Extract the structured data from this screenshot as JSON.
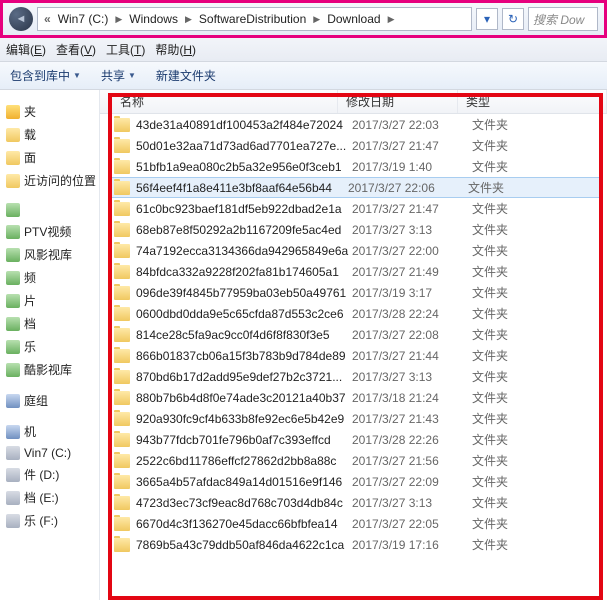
{
  "address": {
    "segments": [
      "Win7 (C:)",
      "Windows",
      "SoftwareDistribution",
      "Download"
    ],
    "search_placeholder": "搜索 Dow"
  },
  "menu": {
    "items": [
      {
        "label": "编辑",
        "hot": "E"
      },
      {
        "label": "查看",
        "hot": "V"
      },
      {
        "label": "工具",
        "hot": "T"
      },
      {
        "label": "帮助",
        "hot": "H"
      }
    ]
  },
  "toolbar": {
    "include": "包含到库中",
    "share": "共享",
    "newfolder": "新建文件夹"
  },
  "sidebar": {
    "groups": [
      {
        "items": [
          {
            "label": "夹",
            "icon": "ic-fav"
          },
          {
            "label": "载",
            "icon": "ic-folder"
          },
          {
            "label": "面",
            "icon": "ic-folder"
          },
          {
            "label": "近访问的位置",
            "icon": "ic-folder"
          }
        ]
      },
      {
        "items": [
          {
            "label": "",
            "icon": "ic-media"
          },
          {
            "label": "PTV视频",
            "icon": "ic-media"
          },
          {
            "label": "风影视库",
            "icon": "ic-media"
          },
          {
            "label": "频",
            "icon": "ic-media"
          },
          {
            "label": "片",
            "icon": "ic-media"
          },
          {
            "label": "档",
            "icon": "ic-media"
          },
          {
            "label": "乐",
            "icon": "ic-media"
          },
          {
            "label": "酷影视库",
            "icon": "ic-media"
          }
        ]
      },
      {
        "items": [
          {
            "label": "庭组",
            "icon": "ic-comp"
          }
        ]
      },
      {
        "items": [
          {
            "label": "机",
            "icon": "ic-comp"
          },
          {
            "label": "Vin7 (C:)",
            "icon": "ic-drive"
          },
          {
            "label": "件 (D:)",
            "icon": "ic-drive"
          },
          {
            "label": "档 (E:)",
            "icon": "ic-drive"
          },
          {
            "label": "乐 (F:)",
            "icon": "ic-drive"
          }
        ]
      }
    ]
  },
  "columns": {
    "name": "名称",
    "date": "修改日期",
    "type": "类型"
  },
  "selected_index": 3,
  "files": [
    {
      "name": "43de31a40891df100453a2f484e72024",
      "date": "2017/3/27 22:03",
      "type": "文件夹"
    },
    {
      "name": "50d01e32aa71d73ad6ad7701ea727e...",
      "date": "2017/3/27 21:47",
      "type": "文件夹"
    },
    {
      "name": "51bfb1a9ea080c2b5a32e956e0f3ceb1",
      "date": "2017/3/19 1:40",
      "type": "文件夹"
    },
    {
      "name": "56f4eef4f1a8e411e3bf8aaf64e56b44",
      "date": "2017/3/27 22:06",
      "type": "文件夹"
    },
    {
      "name": "61c0bc923baef181df5eb922dbad2e1a",
      "date": "2017/3/27 21:47",
      "type": "文件夹"
    },
    {
      "name": "68eb87e8f50292a2b1167209fe5ac4ed",
      "date": "2017/3/27 3:13",
      "type": "文件夹"
    },
    {
      "name": "74a7192ecca3134366da942965849e6a",
      "date": "2017/3/27 22:00",
      "type": "文件夹"
    },
    {
      "name": "84bfdca332a9228f202fa81b174605a1",
      "date": "2017/3/27 21:49",
      "type": "文件夹"
    },
    {
      "name": "096de39f4845b77959ba03eb50a49761",
      "date": "2017/3/19 3:17",
      "type": "文件夹"
    },
    {
      "name": "0600dbd0dda9e5c65cfda87d553c2ce6",
      "date": "2017/3/28 22:24",
      "type": "文件夹"
    },
    {
      "name": "814ce28c5fa9ac9cc0f4d6f8f830f3e5",
      "date": "2017/3/27 22:08",
      "type": "文件夹"
    },
    {
      "name": "866b01837cb06a15f3b783b9d784de89",
      "date": "2017/3/27 21:44",
      "type": "文件夹"
    },
    {
      "name": "870bd6b17d2add95e9def27b2c3721...",
      "date": "2017/3/27 3:13",
      "type": "文件夹"
    },
    {
      "name": "880b7b6b4d8f0e74ade3c20121a40b37",
      "date": "2017/3/18 21:24",
      "type": "文件夹"
    },
    {
      "name": "920a930fc9cf4b633b8fe92ec6e5b42e9",
      "date": "2017/3/27 21:43",
      "type": "文件夹"
    },
    {
      "name": "943b77fdcb701fe796b0af7c393effcd",
      "date": "2017/3/28 22:26",
      "type": "文件夹"
    },
    {
      "name": "2522c6bd11786effcf27862d2bb8a88c",
      "date": "2017/3/27 21:56",
      "type": "文件夹"
    },
    {
      "name": "3665a4b57afdac849a14d01516e9f146",
      "date": "2017/3/27 22:09",
      "type": "文件夹"
    },
    {
      "name": "4723d3ec73cf9eac8d768c703d4db84c",
      "date": "2017/3/27 3:13",
      "type": "文件夹"
    },
    {
      "name": "6670d4c3f136270e45dacc66bfbfea14",
      "date": "2017/3/27 22:05",
      "type": "文件夹"
    },
    {
      "name": "7869b5a43c79ddb50af846da4622c1ca",
      "date": "2017/3/19 17:16",
      "type": "文件夹"
    }
  ]
}
